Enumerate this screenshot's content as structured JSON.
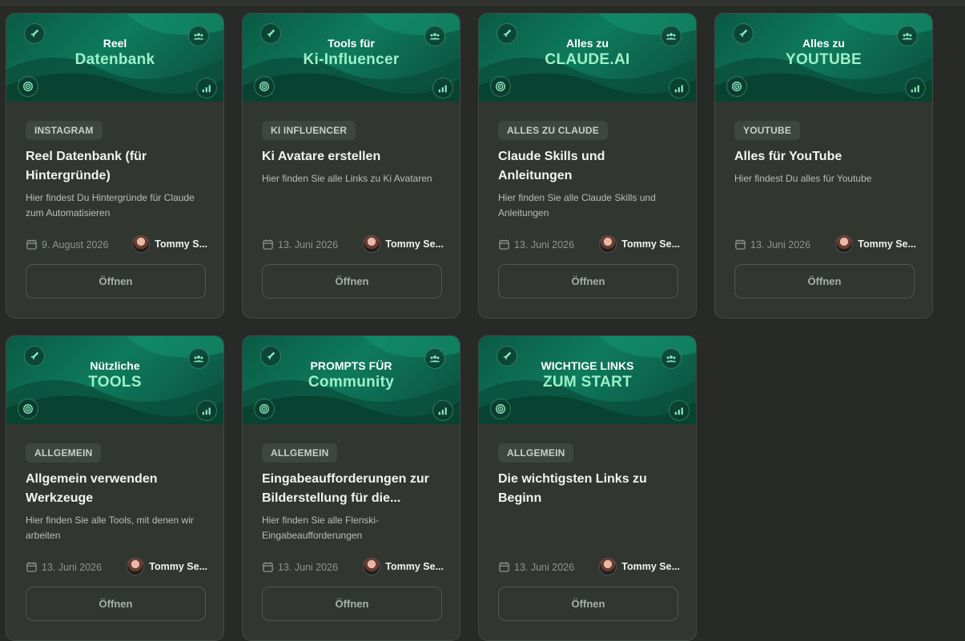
{
  "open_label": "Öffnen",
  "cards": [
    {
      "banner_l1": "Reel",
      "banner_l2": "Datenbank",
      "tag": "INSTAGRAM",
      "title": "Reel Datenbank (für Hintergründe)",
      "desc": "Hier findest Du Hintergründe für Claude zum Automatisieren",
      "date": "9. August 2026",
      "author": "Tommy S..."
    },
    {
      "banner_l1": "Tools für",
      "banner_l2": "Ki-Influencer",
      "tag": "KI INFLUENCER",
      "title": "Ki Avatare erstellen",
      "desc": "Hier finden Sie alle Links zu Ki Avataren",
      "date": "13. Juni 2026",
      "author": "Tommy Se..."
    },
    {
      "banner_l1": "Alles zu",
      "banner_l2": "CLAUDE.AI",
      "tag": "ALLES ZU CLAUDE",
      "title": "Claude Skills und Anleitungen",
      "desc": "Hier finden Sie alle Claude Skills und Anleitungen",
      "date": "13. Juni 2026",
      "author": "Tommy Se..."
    },
    {
      "banner_l1": "Alles zu",
      "banner_l2": "YOUTUBE",
      "tag": "YOUTUBE",
      "title": "Alles für YouTube",
      "desc": "Hier findest Du alles für Youtube",
      "date": "13. Juni 2026",
      "author": "Tommy Se..."
    },
    {
      "banner_l1": "Nützliche",
      "banner_l2": "TOOLS",
      "tag": "ALLGEMEIN",
      "title": "Allgemein verwenden Werkzeuge",
      "desc": "Hier finden Sie alle Tools, mit denen wir arbeiten",
      "date": "13. Juni 2026",
      "author": "Tommy Se..."
    },
    {
      "banner_l1": "PROMPTS FÜR",
      "banner_l2": "Community",
      "tag": "ALLGEMEIN",
      "title": "Eingabeaufforderungen zur Bilderstellung für die...",
      "desc": "Hier finden Sie alle Flenski-Eingabeaufforderungen",
      "date": "13. Juni 2026",
      "author": "Tommy Se..."
    },
    {
      "banner_l1": "WICHTIGE LINKS",
      "banner_l2": "ZUM START",
      "tag": "ALLGEMEIN",
      "title": "Die wichtigsten Links zu Beginn",
      "desc": "",
      "date": "13. Juni 2026",
      "author": "Tommy Se..."
    }
  ],
  "colors": {
    "background": "#272a27",
    "card": "#313631",
    "banner_green": "#0e7a5c",
    "banner_accent": "#9ef0c8"
  },
  "icons": {
    "banner_top_left": "rocket-icon",
    "banner_top_right": "community-icon",
    "banner_bottom_left": "target-icon",
    "banner_bottom_right": "chart-icon",
    "date": "calendar-icon"
  }
}
